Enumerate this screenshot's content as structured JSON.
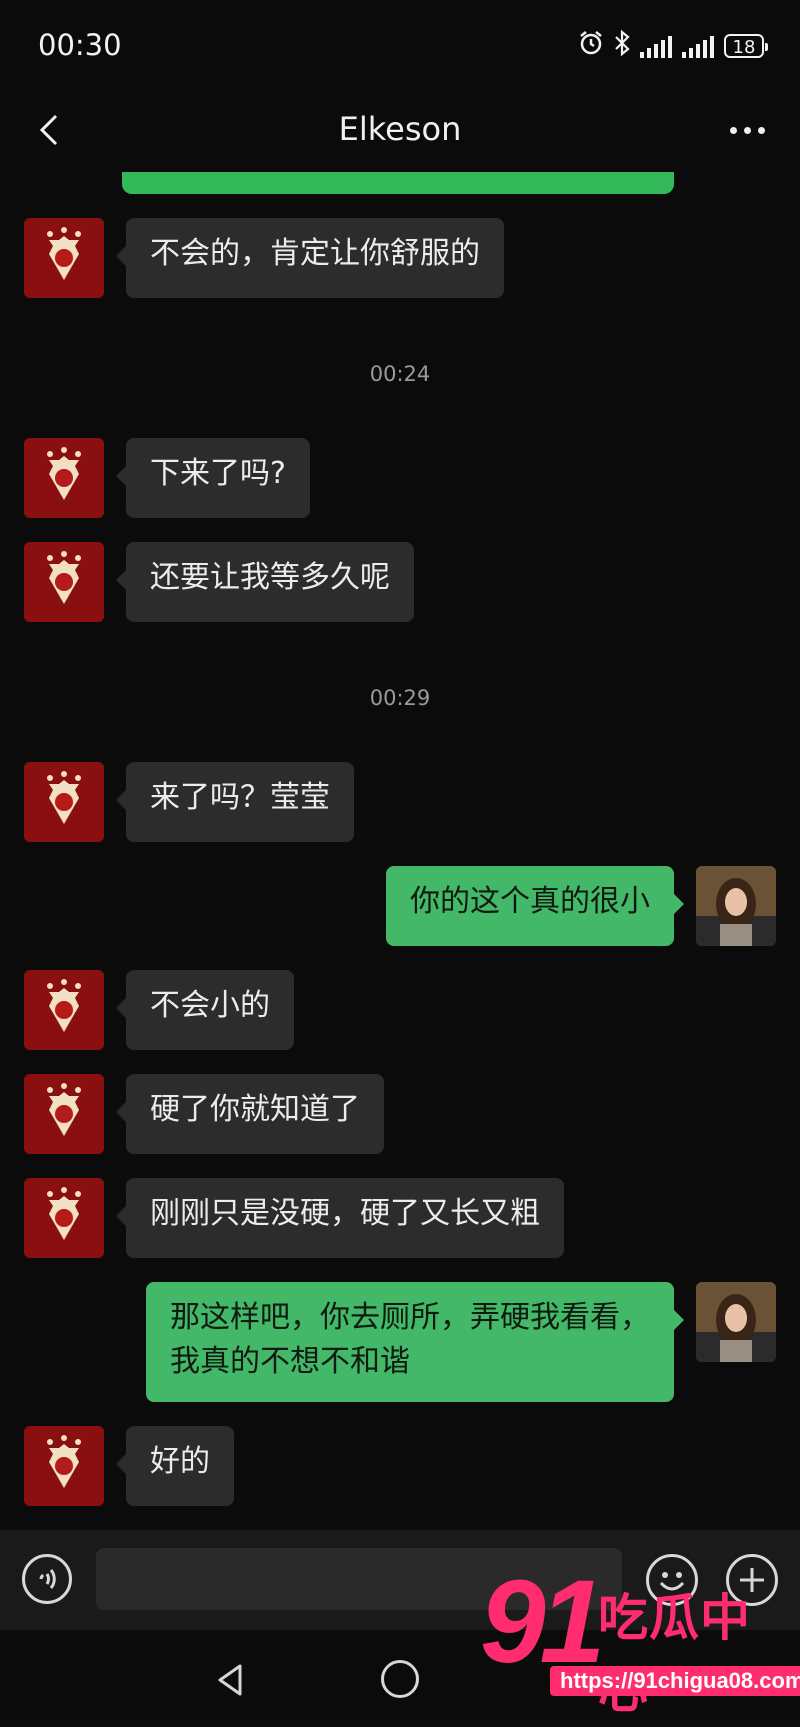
{
  "status_bar": {
    "time": "00:30",
    "battery": "18"
  },
  "header": {
    "title": "Elkeson"
  },
  "messages": [
    {
      "text": "不会的，肯定让你舒服的"
    },
    {
      "text": "下来了吗?"
    },
    {
      "text": "还要让我等多久呢"
    },
    {
      "text": "来了吗？莹莹"
    },
    {
      "text": "你的这个真的很小"
    },
    {
      "text": "不会小的"
    },
    {
      "text": "硬了你就知道了"
    },
    {
      "text": "刚刚只是没硬，硬了又长又粗"
    },
    {
      "text": "那这样吧，你去厕所，弄硬我看看，我真的不想不和谐"
    },
    {
      "text": "好的"
    }
  ],
  "timestamps": [
    "00:24",
    "00:29"
  ],
  "input": {
    "placeholder": ""
  },
  "watermark": {
    "number": "91",
    "name": "吃瓜中心",
    "url": "https://91chigua08.com"
  },
  "colors": {
    "incoming_bubble": "#2c2c2c",
    "outgoing_bubble": "#42b868",
    "background": "#0b0b0b",
    "watermark": "#ff2c6f"
  }
}
